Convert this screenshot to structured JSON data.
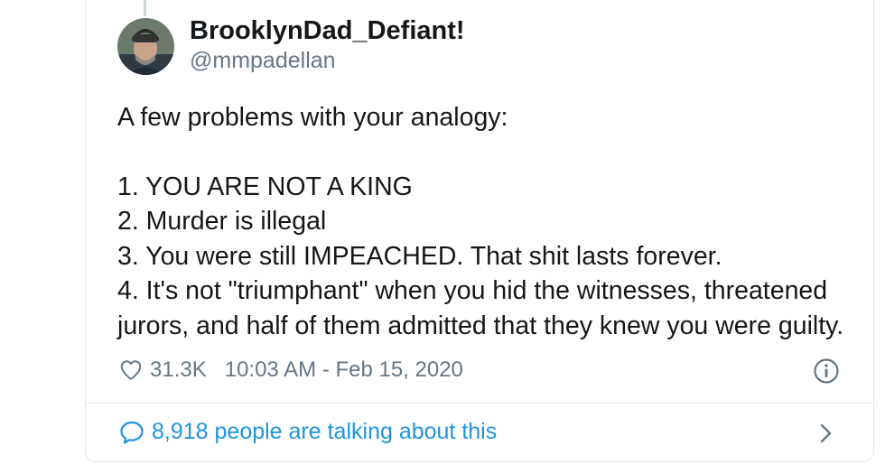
{
  "author": {
    "display_name": "BrooklynDad_Defiant!",
    "handle": "@mmpadellan"
  },
  "tweet": {
    "intro": "A few problems with your analogy:",
    "lines": [
      "1. YOU ARE NOT A KING",
      "2. Murder is illegal",
      "3. You were still IMPEACHED. That shit lasts forever.",
      "4. It's not \"triumphant\" when you hid the witnesses, threatened",
      "jurors, and half of them admitted that they knew you were guilty."
    ]
  },
  "meta": {
    "likes": "31.3K",
    "timestamp": "10:03 AM - Feb 15, 2020"
  },
  "footer": {
    "talking_text": "8,918 people are talking about this"
  },
  "icons": {
    "heart": "heart-icon",
    "info": "info-icon",
    "reply_bubble": "speech-bubble-icon",
    "chevron": "chevron-right-icon"
  },
  "colors": {
    "text": "#14171a",
    "secondary": "#657786",
    "link": "#1b95e0",
    "border": "#e1e8ed"
  }
}
